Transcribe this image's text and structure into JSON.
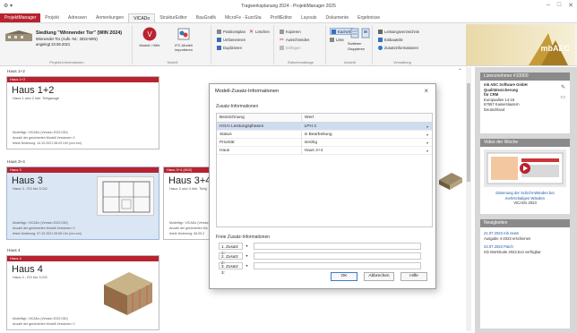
{
  "window": {
    "title": "Tragwerksplanung 2024 - ProjektManager 2025",
    "controls": [
      "–",
      "□",
      "✕"
    ]
  },
  "tabs": [
    "ProjektManager",
    "Projekt",
    "Adressen",
    "Anmerkungen",
    "VICADo",
    "StrukturEditor",
    "BauGrafik",
    "MicroFe - EuroSta",
    "ProfilEditor",
    "Layouts",
    "Dokumente",
    "Ergebnisse"
  ],
  "active_tab": "VICADo",
  "ribbon": {
    "project_name": "Siedlung \"Winnender Tor\" (WIN 2024)",
    "project_line2": "Winnender Tor (Aufn.-Nr.: 2022-WIN)",
    "project_line3": "angelegt 23.08.2021",
    "group_project": "Projekt-Informationen",
    "btn_modell": "Modell / Hilfe",
    "btn_import": "IFC-Modell importieren",
    "group_modell": "Modell",
    "btn_positionsplan": "Positionsplan",
    "btn_loeschen": "Löschen",
    "btn_umbenennen": "Umbenennen",
    "btn_duplizieren": "Duplizieren",
    "btn_kopieren": "Kopieren",
    "btn_ausschneiden": "Ausschneiden",
    "btn_einfuegen": "Einfügen",
    "group_zwischenablage": "Zwischenablage",
    "btn_kacheln": "Kacheln",
    "btn_liste": "Liste",
    "btn_sortieren": "Sortieren",
    "btn_gruppieren": "Gruppieren",
    "group_ansicht": "Ansicht",
    "btn_leistungsverz": "Leistungsverzeichnis",
    "btn_einbauteile": "Einbauteile",
    "btn_zusatzinfo": "Zusatzinformationen",
    "group_verwaltung": "Verwaltung"
  },
  "left": {
    "sections": [
      {
        "header": "Haus 1+2",
        "cards": [
          {
            "bar": "Haus 1+2",
            "name": "Haus 1+2",
            "sub": "Haus 1 und 2 inkl. Tiefgarage",
            "meta1": "Modelltyp: VICADo (Version 2022.030)",
            "meta2": "Anzahl der gesicherten Modell-Versionen: 0",
            "meta3": "letzte Änderung: 14.10.2021 08:29 Uhr (xxx xxx)"
          }
        ]
      },
      {
        "header": "Haus 3+4",
        "cards": [
          {
            "bar": "Haus 3",
            "name": "Haus 3",
            "sub": "Haus 3 - EG bis 3.OG",
            "meta1": "Modelltyp: VICADo (Version 2022.030)",
            "meta2": "Anzahl der gesicherten Modell-Versionen: 0",
            "meta3": "letzte Änderung: 07.10.2021 09:08 Uhr (xxx xxx)"
          },
          {
            "bar": "Haus 3+4 (WIZ)",
            "name": "Haus 3+4 [F",
            "sub": "Haus 3 und 4 inkl. Tiefg",
            "meta1": "Modelltyp: VICADo (Version 2022.030)",
            "meta2": "Anzahl der gesicherten Mo",
            "meta3": "letzte Änderung: 08.09.2"
          }
        ]
      },
      {
        "header": "Haus 4",
        "cards": [
          {
            "bar": "Haus 4",
            "name": "Haus 4",
            "sub": "Haus 4 - EG bis 3.OG",
            "meta1": "Modelltyp: VICADo (Version 2022.030)",
            "meta2": "Anzahl der gesicherten Modell-Versionen: 0",
            "meta3": ""
          }
        ]
      }
    ]
  },
  "right": {
    "license_header": "Lizenznehmer #10000",
    "license_lines": [
      "mb AEC Software GmbH",
      "Qualitätssicherung",
      "für CRM",
      "Europaallee 14-16",
      "67657 Kaiserslautern",
      "Deutschland"
    ],
    "video_header": "Video der Woche",
    "video_caption1": "Dämmung der Schicht-Wänden bei",
    "video_caption2": "mehrschaligen Wänden",
    "video_caption3": "VICADo 2023",
    "news_header": "Neuigkeiten",
    "news": [
      {
        "date": "21.07.2023 mb news",
        "text": "Ausgabe 4-2023 erschienen"
      },
      {
        "date": "24.07.2023 Patch",
        "text": "mb WorkSuite 2023.514 verfügbar"
      }
    ],
    "brand": "mbAEC"
  },
  "dialog": {
    "title": "Modell-Zusatz-Informationen",
    "section1": "Zusatz-Informationen",
    "col_name": "Bezeichnung",
    "col_value": "Wert",
    "rows": [
      {
        "name": "HOAI Leistungsphasen",
        "value": "LPH 4",
        "selected": true
      },
      {
        "name": "Status",
        "value": "in Bearbeitung",
        "selected": false
      },
      {
        "name": "Priorität",
        "value": "niedrig",
        "selected": false
      },
      {
        "name": "Haus",
        "value": "Haus 3+4",
        "selected": false
      }
    ],
    "section2": "Freie Zusatz-Informationen",
    "free": [
      "1. Zusatz 1:",
      "2. Zusatz 2:",
      "3. Zusatz 3:"
    ],
    "ok": "OK",
    "cancel": "Abbrechen",
    "help": "Hilfe"
  }
}
